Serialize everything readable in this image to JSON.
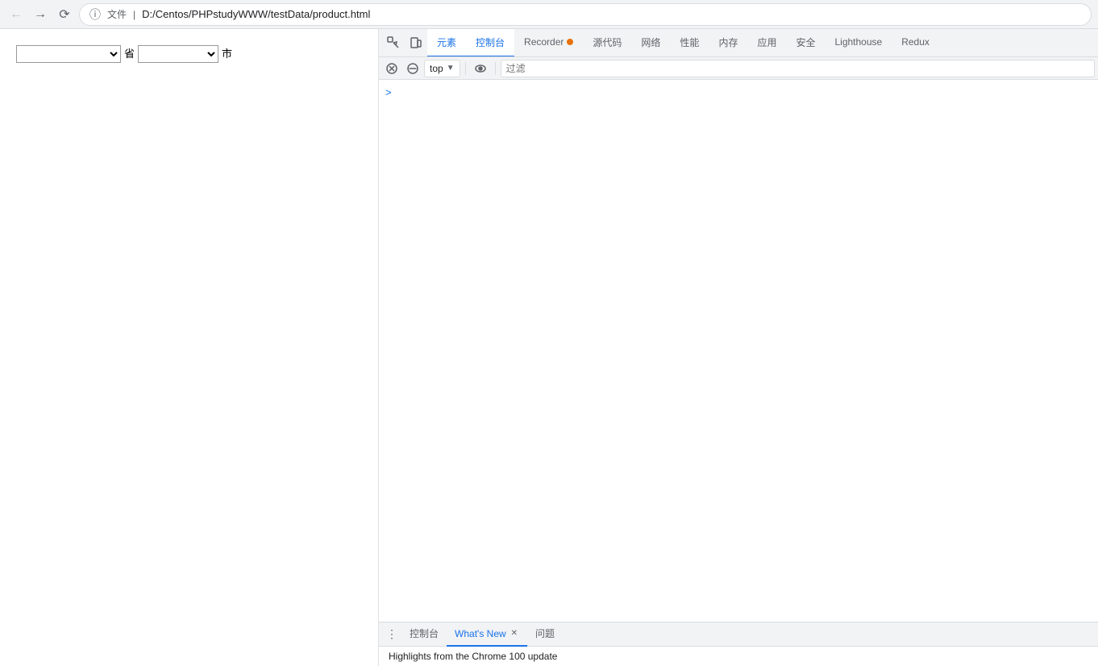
{
  "browser": {
    "url": "D:/Centos/PHPstudyWWW/testData/product.html",
    "file_label": "文件",
    "separator": "|"
  },
  "page": {
    "province_label": "省",
    "city_label": "市"
  },
  "devtools": {
    "tabs": [
      {
        "id": "elements",
        "label": "元素"
      },
      {
        "id": "console",
        "label": "控制台",
        "active": true
      },
      {
        "id": "recorder",
        "label": "Recorder"
      },
      {
        "id": "sources",
        "label": "源代码"
      },
      {
        "id": "network",
        "label": "网络"
      },
      {
        "id": "performance",
        "label": "性能"
      },
      {
        "id": "memory",
        "label": "内存"
      },
      {
        "id": "application",
        "label": "应用"
      },
      {
        "id": "security",
        "label": "安全"
      },
      {
        "id": "lighthouse",
        "label": "Lighthouse"
      },
      {
        "id": "redux",
        "label": "Redux"
      }
    ],
    "toolbar": {
      "top_label": "top",
      "filter_placeholder": "过滤"
    },
    "console_prompt": ">"
  },
  "drawer": {
    "tabs": [
      {
        "id": "console",
        "label": "控制台",
        "closeable": false
      },
      {
        "id": "whats-new",
        "label": "What's New",
        "active": true,
        "closeable": true
      },
      {
        "id": "issues",
        "label": "问题",
        "closeable": false
      }
    ],
    "content": "Highlights from the Chrome 100 update"
  }
}
